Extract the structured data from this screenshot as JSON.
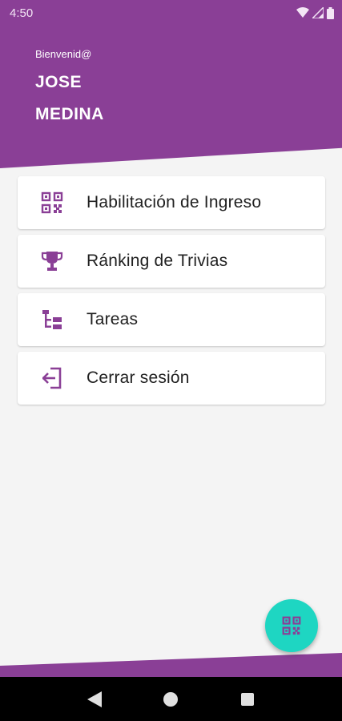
{
  "status_bar": {
    "time": "4:50",
    "icons": [
      "wifi-icon",
      "signal-icon",
      "battery-icon"
    ]
  },
  "header": {
    "welcome": "Bienvenid@",
    "first_name": "JOSE",
    "last_name": "MEDINA"
  },
  "menu": {
    "items": [
      {
        "label": "Habilitación de Ingreso",
        "icon": "qr-code-icon"
      },
      {
        "label": "Ránking de Trivias",
        "icon": "trophy-icon"
      },
      {
        "label": "Tareas",
        "icon": "tasks-icon"
      },
      {
        "label": "Cerrar sesión",
        "icon": "logout-icon"
      }
    ]
  },
  "fab": {
    "icon": "qr-code-icon"
  },
  "nav": {
    "icons": [
      "back-icon",
      "home-icon",
      "recents-icon"
    ]
  },
  "colors": {
    "primary": "#8a3f96",
    "accent": "#1ed6c2",
    "background": "#f4f4f4",
    "text": "#212121"
  }
}
